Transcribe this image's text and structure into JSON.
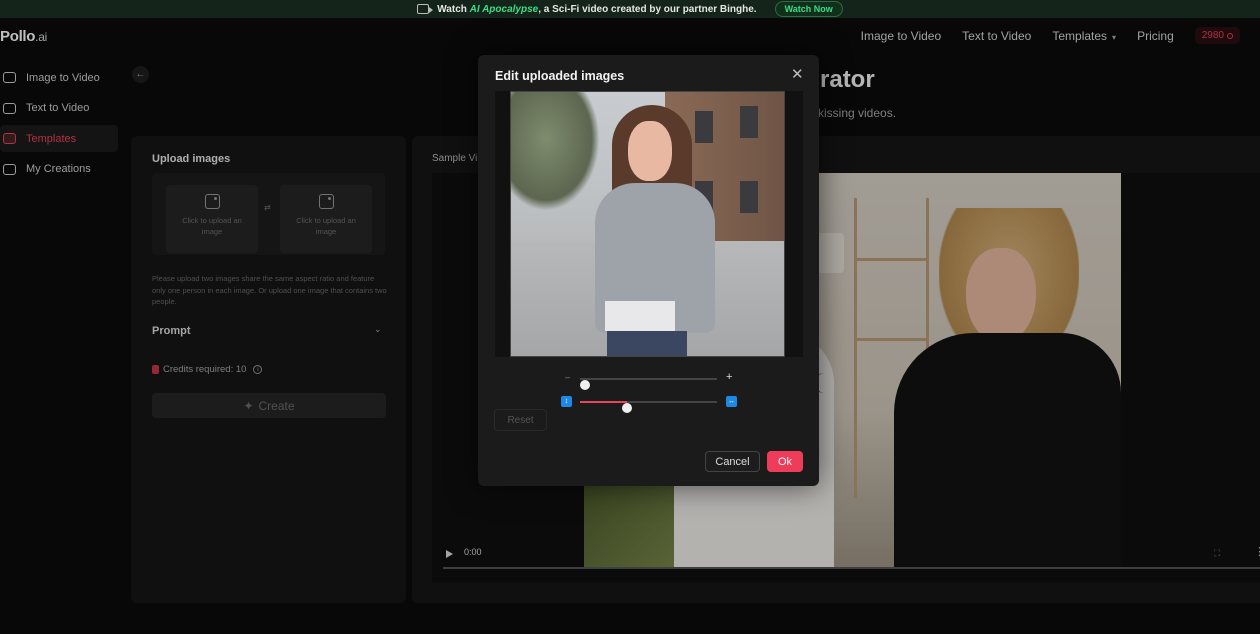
{
  "banner": {
    "prefix": "Watch",
    "highlight": "AI Apocalypse",
    "suffix": ", a Sci-Fi video created by our partner Binghe.",
    "button": "Watch Now"
  },
  "brand": {
    "name": "Pollo",
    "suffix": ".ai"
  },
  "nav": {
    "image_to_video": "Image to Video",
    "text_to_video": "Text to Video",
    "templates": "Templates",
    "pricing": "Pricing",
    "credits": "2980"
  },
  "sidebar": {
    "items": [
      {
        "label": "Image to Video"
      },
      {
        "label": "Text to Video"
      },
      {
        "label": "Templates"
      },
      {
        "label": "My Creations"
      }
    ]
  },
  "page": {
    "title_partial": "rator",
    "subtitle_partial": "kissing videos."
  },
  "left_panel": {
    "upload_title": "Upload images",
    "upload_box_1": "Click to upload an image",
    "upload_box_2": "Click to upload an image",
    "hint": "Please upload two images share the same aspect ratio and feature only one person in each image. Or upload one image that contains two people.",
    "prompt_label": "Prompt",
    "credits_required": "Credits required: 10",
    "create_label": "Create"
  },
  "right_panel": {
    "sample_label": "Sample Vi",
    "video_time": "0:00"
  },
  "modal": {
    "title": "Edit uploaded images",
    "zoom_level": 0,
    "ratio_level": 0.33,
    "reset_label": "Reset",
    "cancel_label": "Cancel",
    "ok_label": "Ok"
  },
  "colors": {
    "accent": "#f03c5b",
    "banner_green": "#3ddc84",
    "ratio_icon": "#1e88e5"
  }
}
